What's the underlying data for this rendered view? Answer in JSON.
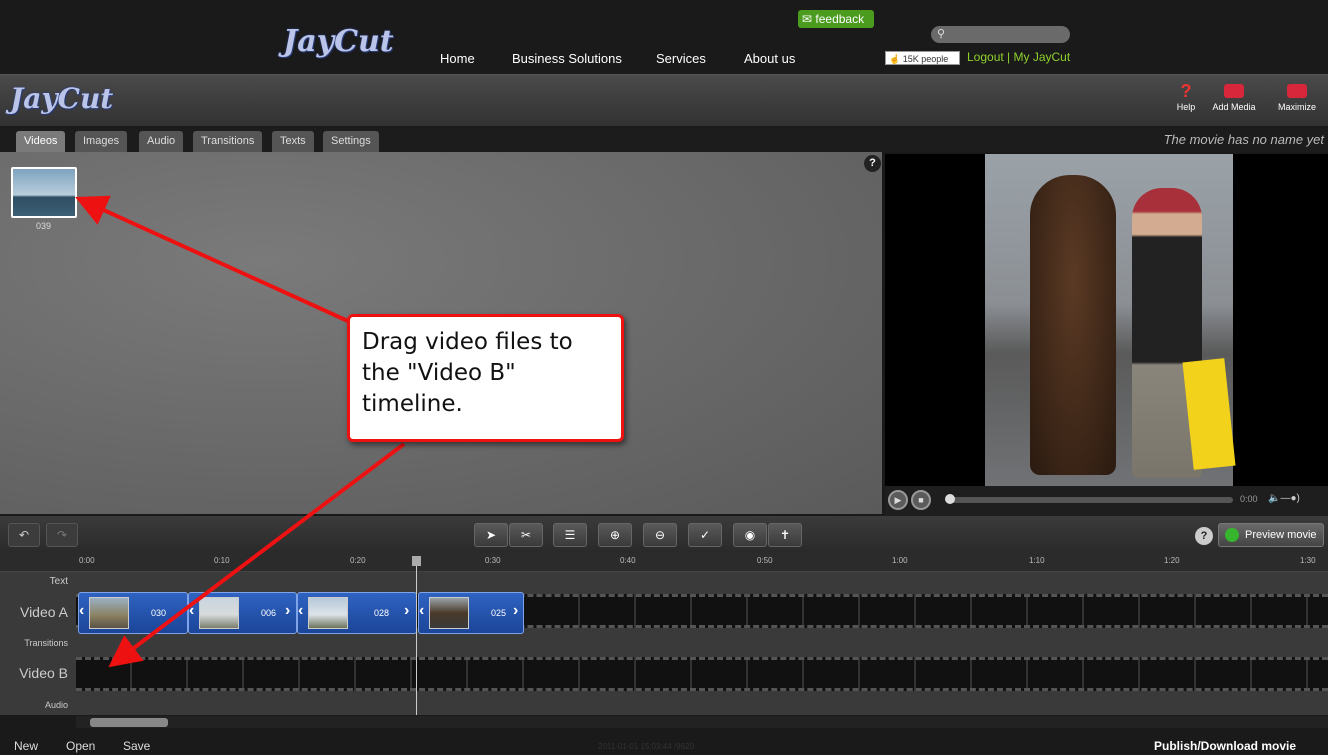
{
  "topnav": {
    "logo": "JayCut",
    "links": [
      "Home",
      "Business Solutions",
      "Services",
      "About us"
    ],
    "feedback": "feedback",
    "like": "15K people",
    "logout": "Logout",
    "separator": "|",
    "myjaycut": "My JayCut"
  },
  "appbar": {
    "logo": "JayCut",
    "help": "Help",
    "add_media": "Add Media",
    "maximize": "Maximize"
  },
  "tabs": [
    "Videos",
    "Images",
    "Audio",
    "Transitions",
    "Texts",
    "Settings"
  ],
  "movie_name": "The movie has no name yet",
  "media": {
    "thumb_label": "039"
  },
  "player": {
    "time": "0:00"
  },
  "toolstrip": {
    "preview_movie": "Preview movie"
  },
  "ruler": [
    "0:00",
    "0:10",
    "0:20",
    "0:30",
    "0:40",
    "0:50",
    "1:00",
    "1:10",
    "1:20",
    "1:30"
  ],
  "tracks": {
    "text": "Text",
    "video_a": "Video A",
    "transitions": "Transitions",
    "video_b": "Video B",
    "audio": "Audio"
  },
  "clips": [
    {
      "num": "030"
    },
    {
      "num": "006"
    },
    {
      "num": "028"
    },
    {
      "num": "025"
    }
  ],
  "bottom": {
    "new": "New",
    "open": "Open",
    "save": "Save",
    "stamp": "2011-01-01 15:03:44 /9620",
    "publish": "Publish/Download movie"
  },
  "callout": "Drag video files to the \"Video B\" timeline.",
  "colors": {
    "accent_green": "#8fd12d",
    "clip_blue": "#2f63c2",
    "callout_red": "#e11111"
  }
}
